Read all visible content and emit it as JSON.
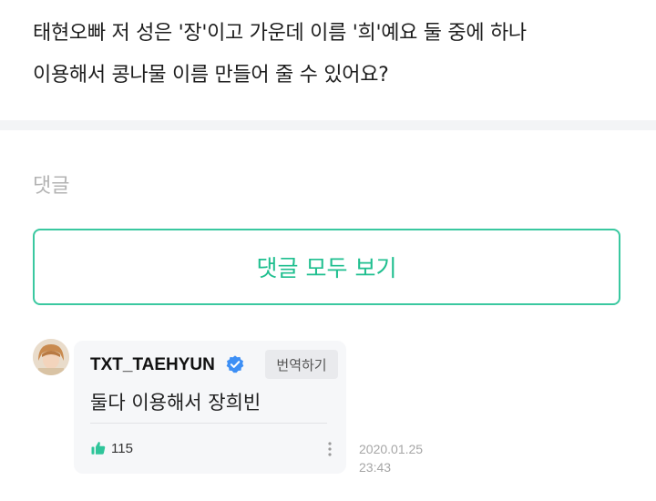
{
  "post": {
    "line1": "태현오빠 저 성은 '장'이고 가운데 이름 '희'예요 둘 중에 하나",
    "line2": "이용해서 콩나물 이름 만들어 줄 수 있어요?"
  },
  "comments": {
    "heading": "댓글",
    "view_all_label": "댓글 모두 보기"
  },
  "reply": {
    "author": "TXT_TAEHYUN",
    "verified_icon": "verified-check-icon",
    "translate_label": "번역하기",
    "body": "둘다 이용해서 장희빈",
    "likes": "115",
    "like_icon": "thumbs-up-icon",
    "more_icon": "more-vertical-icon",
    "date": "2020.01.25",
    "time": "23:43"
  },
  "colors": {
    "accent": "#1fbf8f",
    "accent_border": "#3ac8a0",
    "verified": "#3d8ff5",
    "like_icon": "#2fc59a"
  }
}
